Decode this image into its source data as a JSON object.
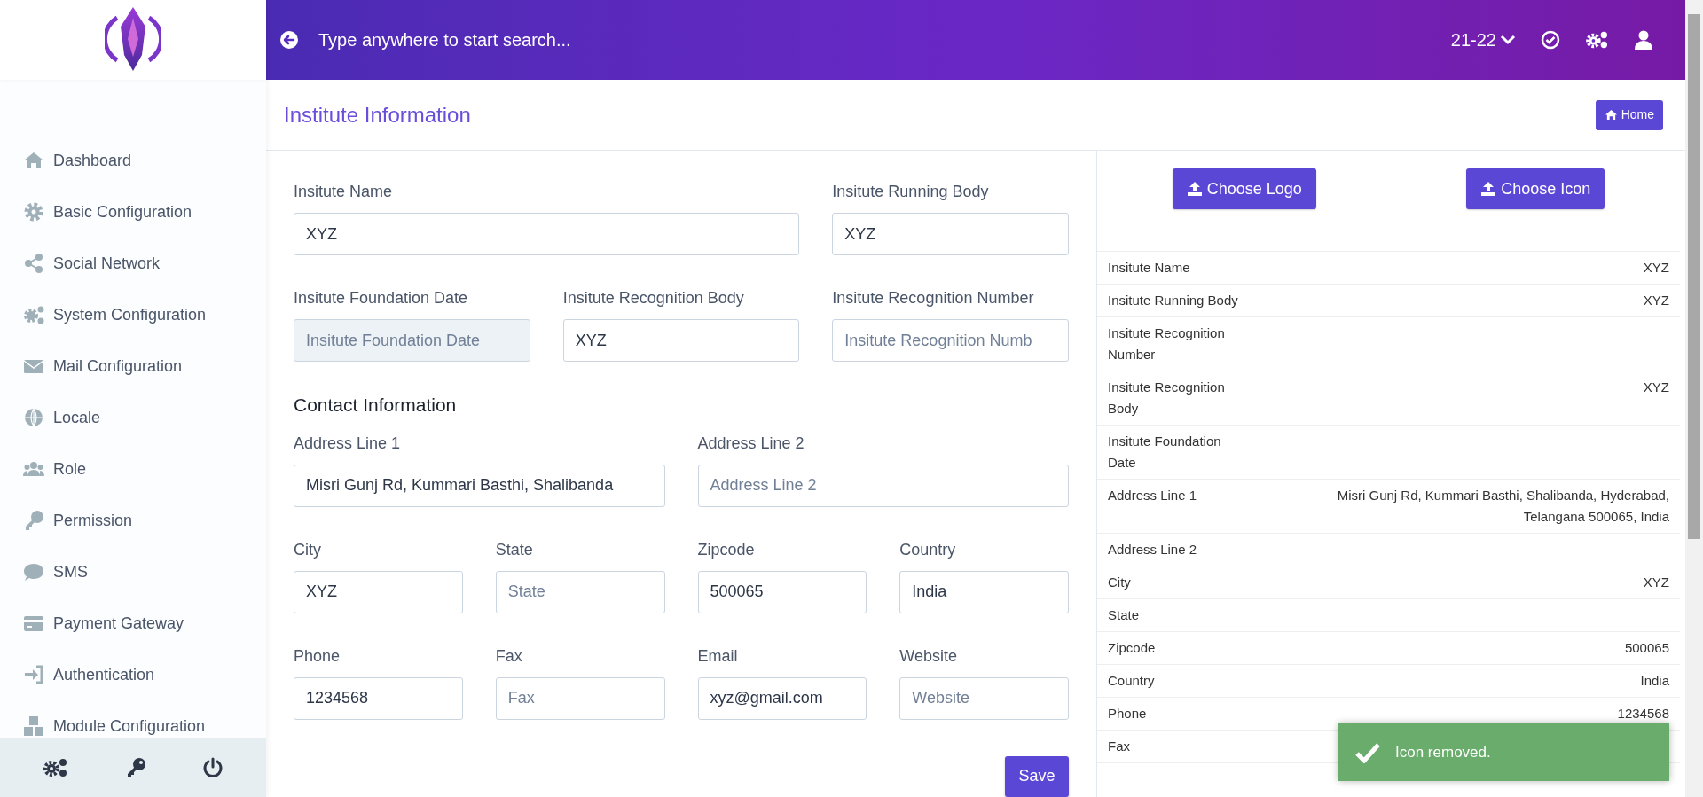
{
  "sidebar": {
    "items": [
      {
        "label": "Dashboard"
      },
      {
        "label": "Basic Configuration"
      },
      {
        "label": "Social Network"
      },
      {
        "label": "System Configuration"
      },
      {
        "label": "Mail Configuration"
      },
      {
        "label": "Locale"
      },
      {
        "label": "Role"
      },
      {
        "label": "Permission"
      },
      {
        "label": "SMS"
      },
      {
        "label": "Payment Gateway"
      },
      {
        "label": "Authentication"
      },
      {
        "label": "Module Configuration"
      }
    ]
  },
  "header": {
    "search": {
      "placeholder": "Type anywhere to start search..."
    },
    "year": "21-22"
  },
  "page": {
    "title": "Institute Information",
    "home_button": "Home"
  },
  "form": {
    "sections": [
      {
        "fields": [
          {
            "label": "Insitute Name",
            "value": "XYZ",
            "disabled": false
          },
          {
            "label": "Insitute Running Body",
            "value": "XYZ",
            "disabled": false
          },
          {
            "label": "Insitute Foundation Date",
            "placeholder": "Insitute Foundation Date",
            "disabled": true
          },
          {
            "label": "Insitute Recognition Body",
            "value": "XYZ",
            "disabled": false
          },
          {
            "label": "Insitute Recognition Number",
            "placeholder": "Insitute Recognition Numb",
            "disabled": false
          }
        ]
      },
      {
        "title": "Contact Information",
        "fields": [
          {
            "label": "Address Line 1",
            "value": "Misri Gunj Rd, Kummari Basthi, Shalibanda",
            "disabled": false
          },
          {
            "label": "Address Line 2",
            "placeholder": "Address Line 2",
            "disabled": false
          },
          {
            "label": "City",
            "value": "XYZ",
            "disabled": false
          },
          {
            "label": "State",
            "placeholder": "State",
            "disabled": false
          },
          {
            "label": "Zipcode",
            "value": "500065",
            "disabled": false
          },
          {
            "label": "Country",
            "value": "India",
            "disabled": false
          },
          {
            "label": "Phone",
            "value": "1234568",
            "disabled": false
          },
          {
            "label": "Fax",
            "placeholder": "Fax",
            "disabled": false
          },
          {
            "label": "Email",
            "value": "xyz@gmail.com",
            "disabled": false
          },
          {
            "label": "Website",
            "placeholder": "Website",
            "disabled": false
          }
        ]
      }
    ],
    "save_button": "Save"
  },
  "uploads": [
    "Choose Logo",
    "Choose Icon"
  ],
  "details": [
    {
      "label": "Insitute Name",
      "value": "XYZ"
    },
    {
      "label": "Insitute Running Body",
      "value": "XYZ"
    },
    {
      "label": "Insitute Recognition Number"
    },
    {
      "label": "Insitute Recognition Body",
      "value": "XYZ"
    },
    {
      "label": "Insitute Foundation Date"
    },
    {
      "label": "Address Line 1",
      "value": "Misri Gunj Rd, Kummari Basthi, Shalibanda, Hyderabad, Telangana 500065, India"
    },
    {
      "label": "Address Line 2"
    },
    {
      "label": "City",
      "value": "XYZ"
    },
    {
      "label": "State"
    },
    {
      "label": "Zipcode",
      "value": "500065"
    },
    {
      "label": "Country",
      "value": "India"
    },
    {
      "label": "Phone",
      "value": "1234568"
    },
    {
      "label": "Fax"
    }
  ],
  "toast": {
    "message": "Icon removed."
  }
}
